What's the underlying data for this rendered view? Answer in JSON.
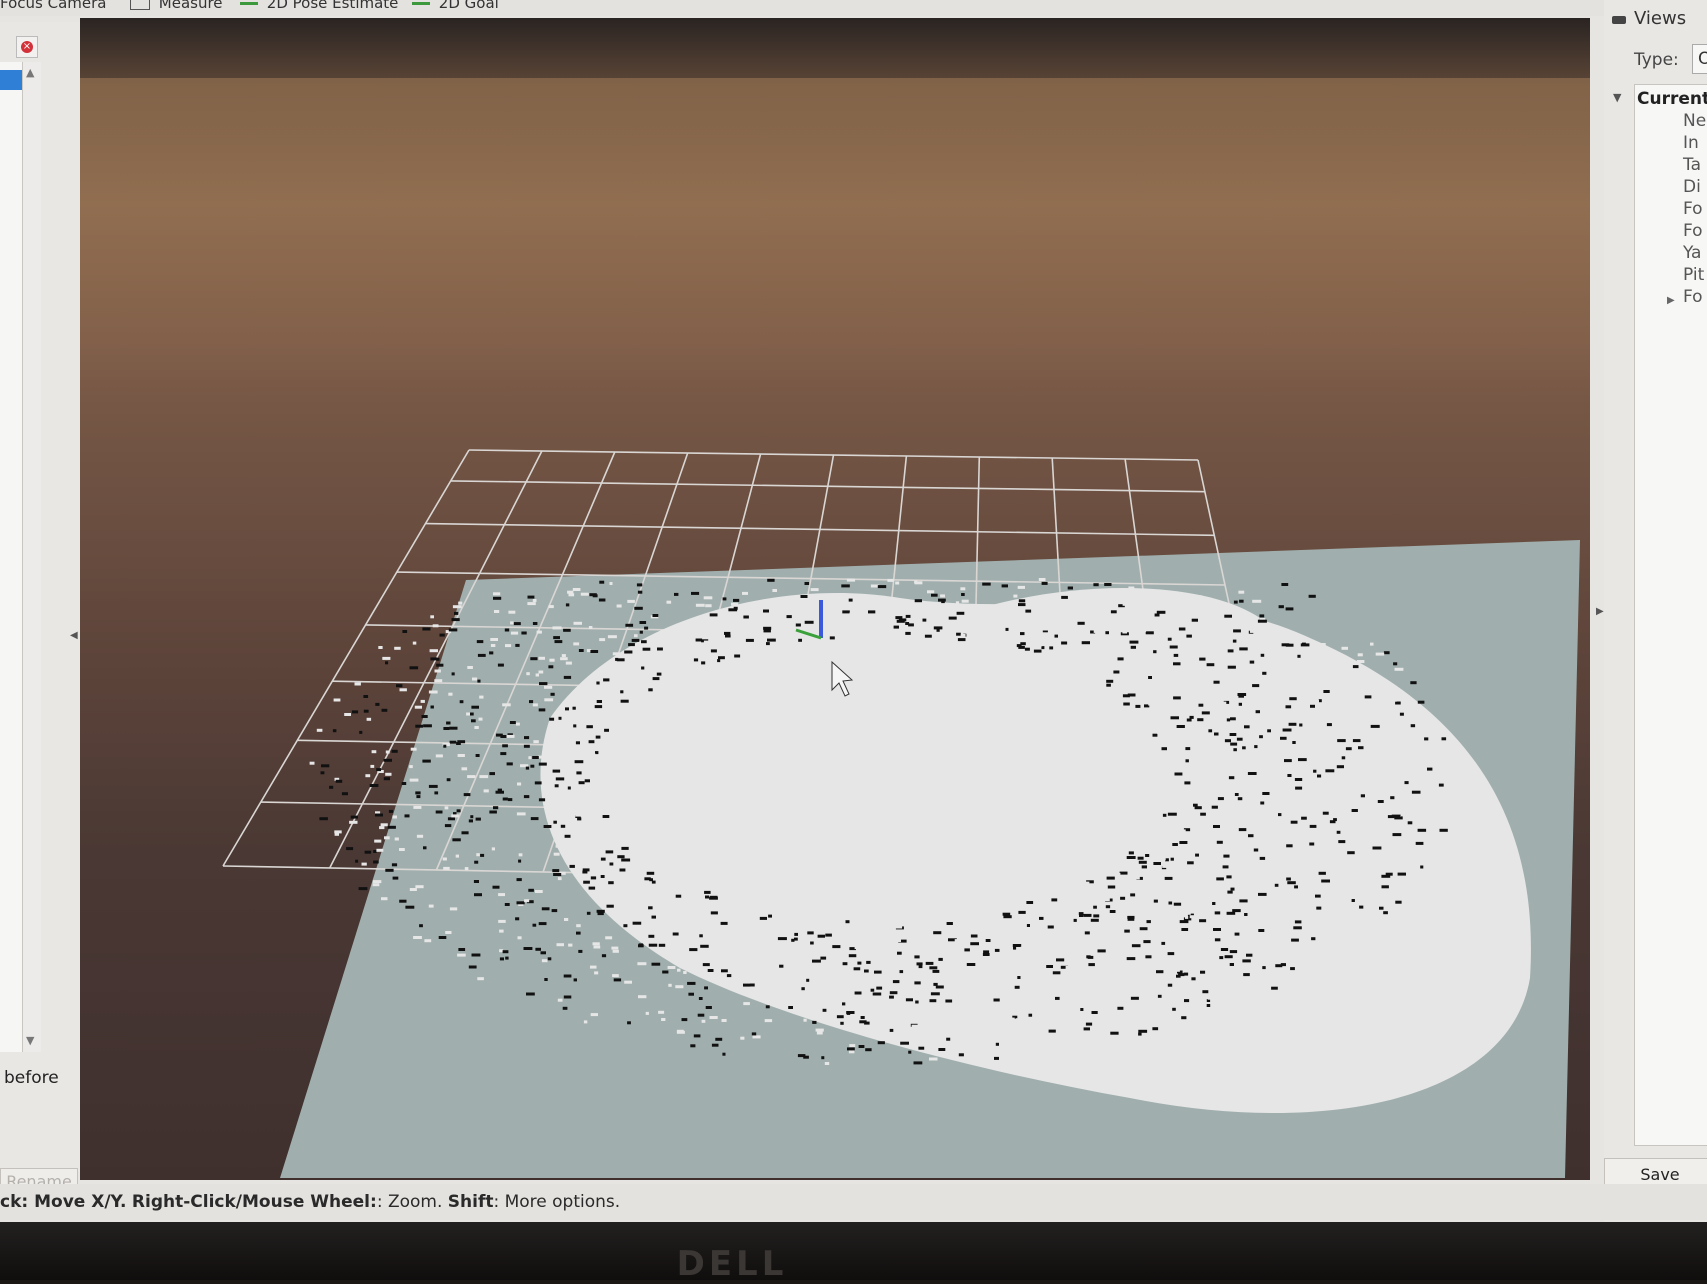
{
  "toolbar": {
    "items": [
      {
        "label": "Focus Camera"
      },
      {
        "label": "Measure"
      },
      {
        "label": "2D Pose Estimate"
      },
      {
        "label": "2D Goal"
      }
    ]
  },
  "left_panel": {
    "close_symbol": "×",
    "partial_text": "before",
    "rename_label": "Rename"
  },
  "right_panel": {
    "title": "Views",
    "type_label": "Type:",
    "type_value": "O",
    "current_view": "Current",
    "properties": [
      "Ne",
      "In",
      "Ta",
      "Di",
      "Fo",
      "Fo",
      "Ya",
      "Pit",
      "Fo"
    ],
    "save_label": "Save"
  },
  "status_bar": {
    "left_action": "ck: Move X/Y.",
    "right_click_label": "Right-Click/Mouse Wheel:",
    "right_click_action": ": Zoom.",
    "shift_label": "Shift",
    "shift_action": ": More options."
  },
  "monitor": {
    "logo": "DELL"
  },
  "colors": {
    "map_unknown": "#a0afae",
    "map_free": "#e6e6e6",
    "map_occupied": "#111111",
    "grid_line": "#d9d6d4",
    "selection": "#2f7fd6"
  }
}
